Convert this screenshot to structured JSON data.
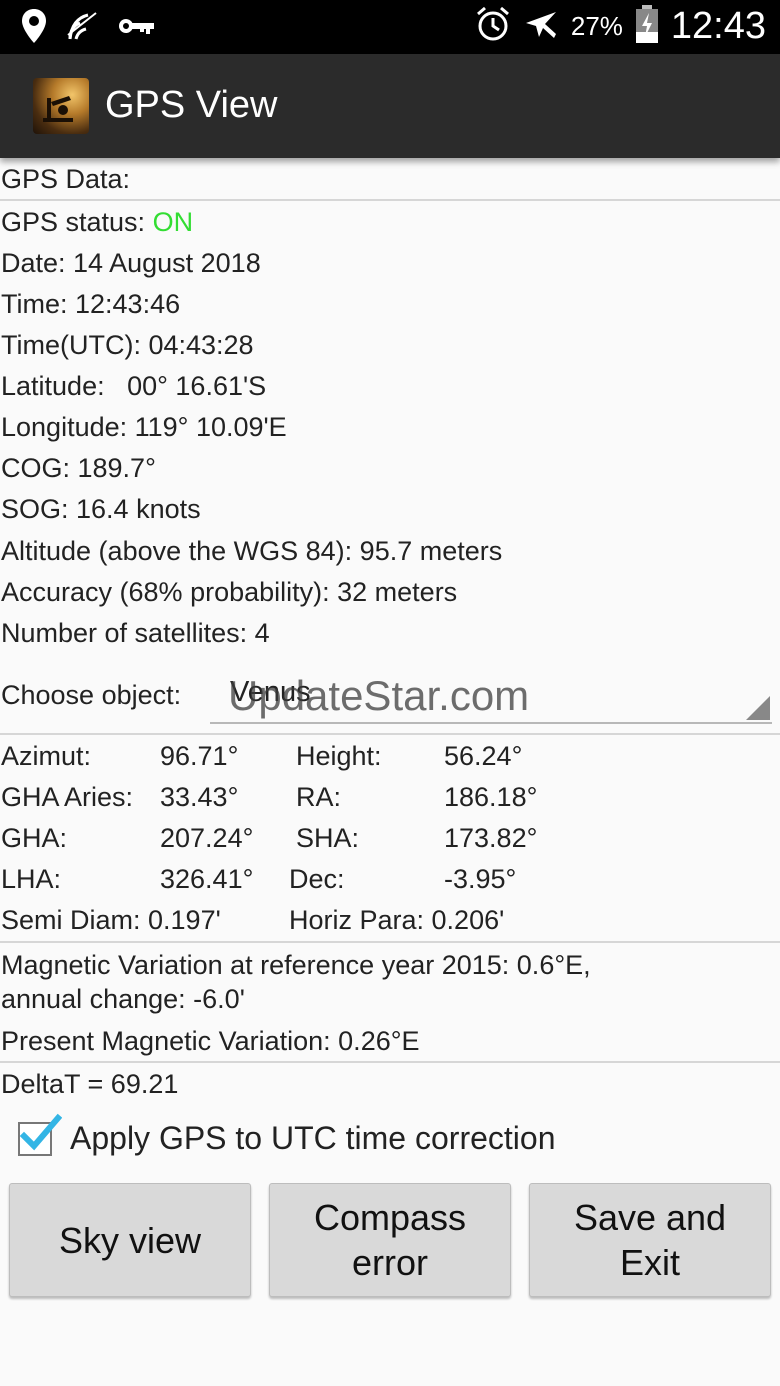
{
  "status_bar": {
    "battery_pct": "27%",
    "clock": "12:43"
  },
  "app": {
    "title": "GPS View"
  },
  "gps": {
    "header": "GPS Data:",
    "status_label": "GPS status: ",
    "status_value": "ON",
    "date": "Date: 14 August 2018",
    "time": "Time: 12:43:46",
    "time_utc": "Time(UTC): 04:43:28",
    "latitude": "Latitude:   00° 16.61'S",
    "longitude": "Longitude: 119° 10.09'E",
    "cog": "COG: 189.7°",
    "sog": "SOG: 16.4 knots",
    "altitude": "Altitude (above the WGS 84): 95.7 meters",
    "accuracy": "Accuracy (68% probability): 32 meters",
    "satellites": "Number of satellites: 4"
  },
  "object": {
    "label": "Choose object:",
    "selected": "Venus",
    "watermark": "UpdateStar.com"
  },
  "celestial": {
    "azimut_label": "Azimut:",
    "azimut_value": "96.71°",
    "height_label": "Height:",
    "height_value": "56.24°",
    "gha_aries_label": "GHA Aries:",
    "gha_aries_value": "33.43°",
    "ra_label": "RA:",
    "ra_value": "186.18°",
    "gha_label": "GHA:",
    "gha_value": "207.24°",
    "sha_label": "SHA:",
    "sha_value": "173.82°",
    "lha_label": "LHA:",
    "lha_value": "326.41°",
    "dec_label": "Dec:",
    "dec_value": "-3.95°",
    "semi_diam": "Semi Diam: 0.197'",
    "horiz_para": "Horiz Para: 0.206'"
  },
  "magnetic": {
    "line1": "Magnetic Variation at reference year 2015: 0.6°E,",
    "line2": "annual change: -6.0'",
    "present": "Present Magnetic Variation: 0.26°E"
  },
  "delta_t": "DeltaT = 69.21",
  "checkbox": {
    "label": "Apply GPS to UTC time correction",
    "checked": true,
    "check_color": "#33b5e5"
  },
  "buttons": {
    "sky_view": "Sky view",
    "compass_error_1": "Compass",
    "compass_error_2": "error",
    "save_exit_1": "Save and",
    "save_exit_2": "Exit"
  }
}
